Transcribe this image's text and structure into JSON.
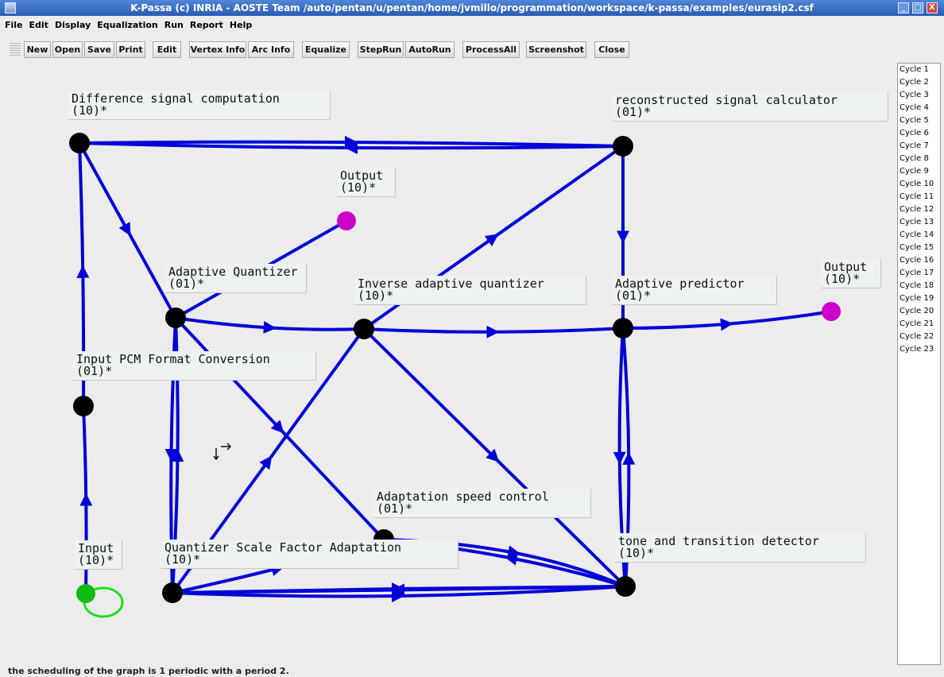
{
  "window": {
    "title": "K-Passa (c) INRIA - AOSTE Team /auto/pentan/u/pentan/home/jvmillo/programmation/workspace/k-passa/examples/eurasip2.csf",
    "controls": [
      "_",
      "□",
      "X"
    ]
  },
  "menu": [
    "File",
    "Edit",
    "Display",
    "Equalization",
    "Run",
    "Report",
    "Help"
  ],
  "toolbar": [
    "New",
    "Open",
    "Save",
    "Print",
    "Edit",
    "Vertex Info",
    "Arc Info",
    "Equalize",
    "StepRun",
    "AutoRun",
    "ProcessAll",
    "Screenshot",
    "Close"
  ],
  "colors": {
    "arc": "#0000d8",
    "node": "#000000",
    "output_node": "#cc00cc",
    "input_node": "#11bb11",
    "self_loop": "#22dd22"
  },
  "graph": {
    "nodes": [
      {
        "id": "diff",
        "name": "Difference signal computation",
        "rate": "(10)*",
        "kind": "normal"
      },
      {
        "id": "recon",
        "name": "reconstructed signal calculator",
        "rate": "(01)*",
        "kind": "normal"
      },
      {
        "id": "out1",
        "name": "Output",
        "rate": "(10)*",
        "kind": "output"
      },
      {
        "id": "aq",
        "name": "Adaptive Quantizer",
        "rate": "(01)*",
        "kind": "normal"
      },
      {
        "id": "iaq",
        "name": "Inverse adaptive quantizer",
        "rate": "(10)*",
        "kind": "normal"
      },
      {
        "id": "ap",
        "name": "Adaptive predictor",
        "rate": "(01)*",
        "kind": "normal"
      },
      {
        "id": "out2",
        "name": "Output",
        "rate": "(10)*",
        "kind": "output"
      },
      {
        "id": "pcm",
        "name": "Input PCM Format Conversion",
        "rate": "(01)*",
        "kind": "normal"
      },
      {
        "id": "asc",
        "name": "Adaptation speed control",
        "rate": "(01)*",
        "kind": "normal"
      },
      {
        "id": "input",
        "name": "Input",
        "rate": "(10)*",
        "kind": "input"
      },
      {
        "id": "qsfa",
        "name": "Quantizer Scale Factor Adaptation",
        "rate": "(10)*",
        "kind": "normal"
      },
      {
        "id": "ttd",
        "name": "tone and transition detector",
        "rate": "(10)*",
        "kind": "normal"
      }
    ]
  },
  "cycles": [
    "Cycle 1",
    "Cycle 2",
    "Cycle 3",
    "Cycle 4",
    "Cycle 5",
    "Cycle 6",
    "Cycle 7",
    "Cycle 8",
    "Cycle 9",
    "Cycle 10",
    "Cycle 11",
    "Cycle 12",
    "Cycle 13",
    "Cycle 14",
    "Cycle 15",
    "Cycle 16",
    "Cycle 17",
    "Cycle 18",
    "Cycle 19",
    "Cycle 20",
    "Cycle 21",
    "Cycle 22",
    "Cycle 23"
  ],
  "status": "the scheduling of the graph is 1 periodic with a period 2."
}
